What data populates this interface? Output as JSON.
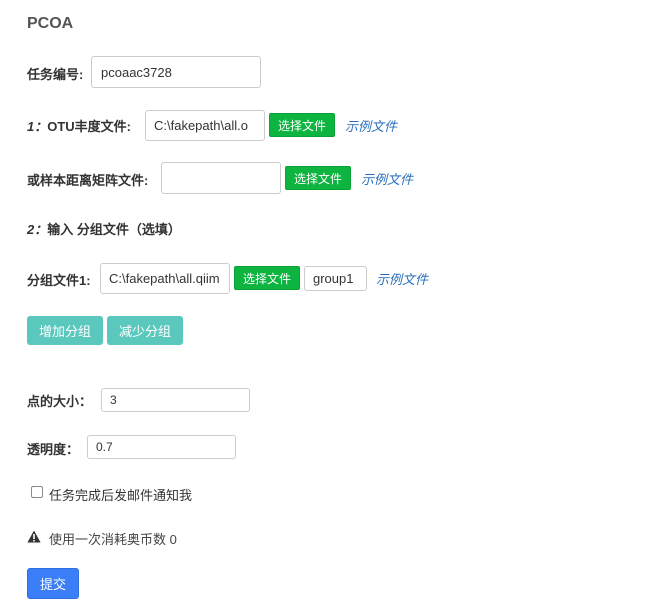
{
  "page": {
    "title": "PCOA"
  },
  "task": {
    "label": "任务编号:",
    "value": "pcoaac3728"
  },
  "step1": {
    "num": "1：",
    "label": "OTU丰度文件:",
    "file_value": "C:\\fakepath\\all.o",
    "choose_label": "选择文件",
    "example_label": "示例文件"
  },
  "matrix": {
    "label": "或样本距离矩阵文件:",
    "file_value": "",
    "choose_label": "选择文件",
    "example_label": "示例文件"
  },
  "step2": {
    "num": "2：",
    "label": "输入 分组文件（选填）"
  },
  "group": {
    "label": "分组文件1:",
    "file_value": "C:\\fakepath\\all.qiim",
    "choose_label": "选择文件",
    "name_value": "group1",
    "example_label": "示例文件",
    "add_label": "增加分组",
    "remove_label": "减少分组"
  },
  "point_size": {
    "label": "点的大小：",
    "value": "3"
  },
  "opacity": {
    "label": "透明度：",
    "value": "0.7"
  },
  "notify": {
    "label": "任务完成后发邮件通知我",
    "checked": false
  },
  "cost": {
    "icon": "warning-icon",
    "text": "使用一次消耗奥币数 0"
  },
  "submit": {
    "label": "提交"
  },
  "colors": {
    "green_button": "#0db540",
    "teal_button": "#5bc8bd",
    "blue_button": "#3a7ff8",
    "link": "#2a6ebb"
  }
}
